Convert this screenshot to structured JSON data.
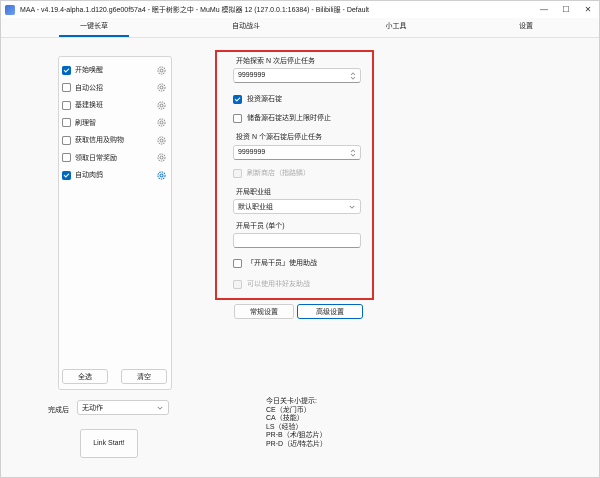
{
  "window": {
    "title": "MAA - v4.19.4-alpha.1.d120.g6e00f57a4 - 眠于树影之中 - MuMu 模拟器 12 (127.0.0.1:16384) - Bilibili服 - Default",
    "minimize_glyph": "—",
    "maximize_glyph": "☐",
    "close_glyph": "✕"
  },
  "tabs": [
    {
      "label": "一键长草",
      "active": true
    },
    {
      "label": "自动战斗",
      "active": false
    },
    {
      "label": "小工具",
      "active": false
    },
    {
      "label": "设置",
      "active": false
    }
  ],
  "tasks": [
    {
      "label": "开始唤醒",
      "checked": true
    },
    {
      "label": "自动公招",
      "checked": false
    },
    {
      "label": "基建换班",
      "checked": false
    },
    {
      "label": "刷理智",
      "checked": false
    },
    {
      "label": "获取信用及购物",
      "checked": false
    },
    {
      "label": "领取日常奖励",
      "checked": false
    },
    {
      "label": "自动肉鸽",
      "checked": true
    }
  ],
  "task_buttons": {
    "select_all": "全选",
    "clear": "清空"
  },
  "after_complete": {
    "label": "完成后",
    "value": "无动作"
  },
  "link_start": "Link Start!",
  "roguelike": {
    "start_explore_label": "开始探索 N 次后停止任务",
    "start_explore_value": "9999999",
    "invest_label": "投资源石锭",
    "invest_checked": true,
    "stop_when_full_label": "储备源石锭达到上限时停止",
    "stop_when_full_checked": false,
    "invest_n_label": "投资 N 个源石锭后停止任务",
    "invest_n_value": "9999999",
    "refresh_shop_label": "刷新商店（指路鳞）",
    "start_class_label": "开局职业组",
    "start_class_value": "默认职业组",
    "start_operator_label": "开局干员 (单个)",
    "start_operator_value": "",
    "use_support_label": "「开局干员」使用助战",
    "use_nonfriend_label": "可以使用非好友助战"
  },
  "mode_buttons": {
    "normal": "常规设置",
    "advanced": "高级设置"
  },
  "tips": {
    "title": "今日关卡小提示:",
    "lines": [
      "CE（龙门币）",
      "CA（技能）",
      "LS（经验）",
      "PR-B（术/狙芯片）",
      "PR-D（近/特芯片）"
    ]
  },
  "icons": {
    "app": "maa-app-icon",
    "gear": "gear-icon",
    "chevron": "chevron-down-icon",
    "spinner": "spinner-arrows-icon"
  },
  "colors": {
    "accent": "#0067c0",
    "highlight_box": "#d8312c"
  }
}
